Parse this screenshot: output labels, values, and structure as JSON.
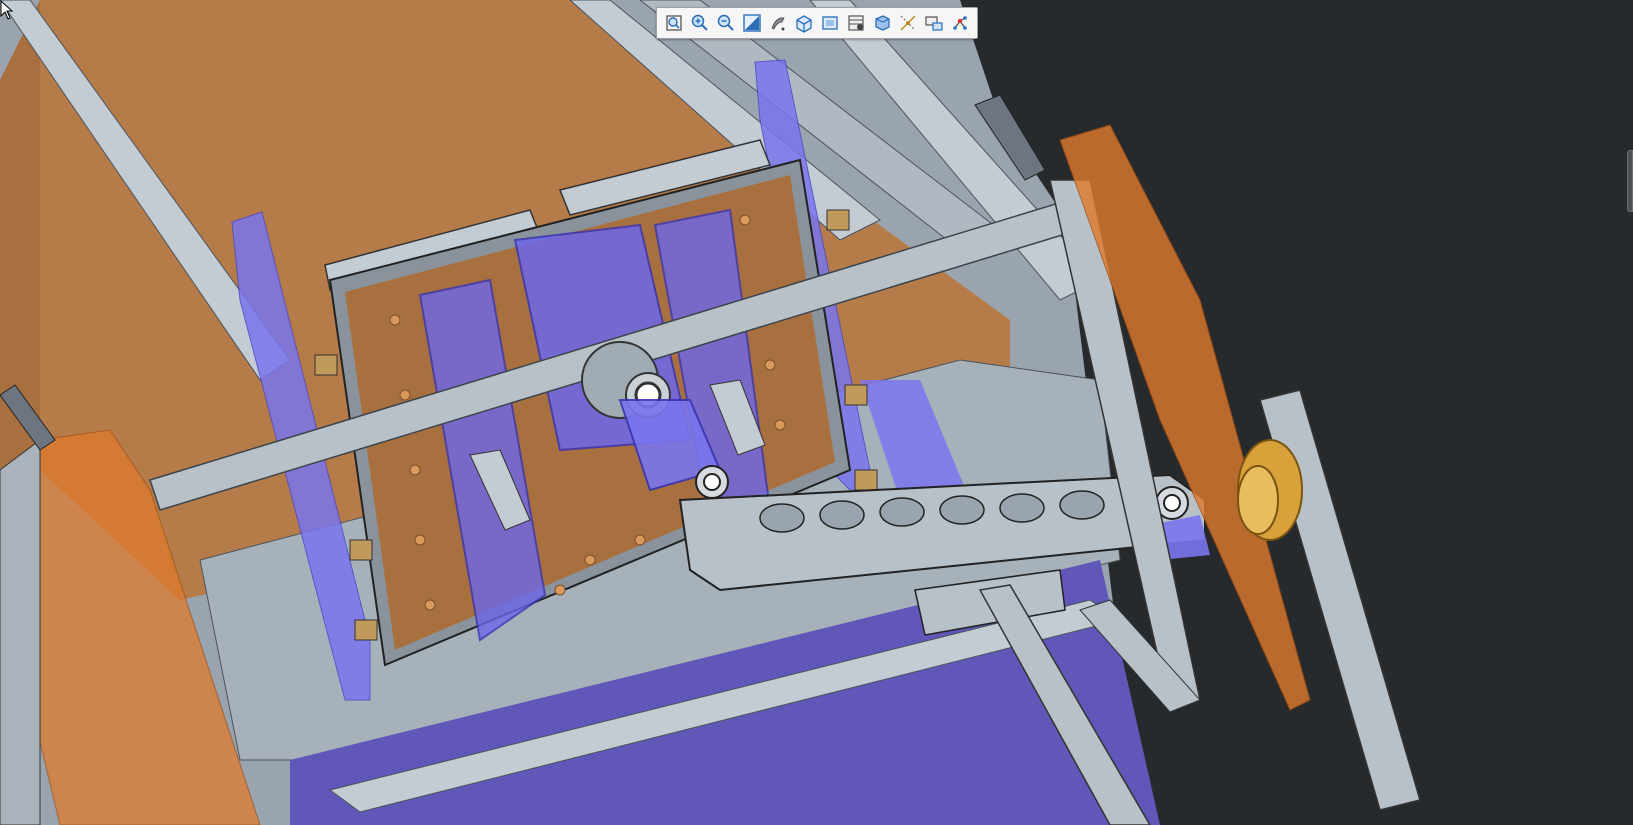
{
  "app": {
    "view": "3d-cad-assembly-viewport"
  },
  "colors": {
    "background": "#262a2c",
    "steel": "#b8c0c8",
    "steel_dark": "#8f99a3",
    "wood": "#b57c4a",
    "transparent_orange": "#e07a2d",
    "transparent_blue": "#6b6bf2",
    "bearing_gold": "#d9a13a"
  },
  "toolbar": {
    "buttons": [
      {
        "icon": "zoom-fit-icon",
        "name": "zoom-fit-button"
      },
      {
        "icon": "zoom-in-icon",
        "name": "zoom-in-button"
      },
      {
        "icon": "zoom-out-icon",
        "name": "zoom-out-button"
      },
      {
        "icon": "zoom-window-icon",
        "name": "zoom-window-button"
      },
      {
        "icon": "repaint-icon",
        "name": "repaint-button"
      },
      {
        "icon": "display-style-icon",
        "name": "display-style-button"
      },
      {
        "icon": "saved-views-icon",
        "name": "saved-views-button"
      },
      {
        "icon": "view-manager-icon",
        "name": "view-manager-button"
      },
      {
        "icon": "perspective-icon",
        "name": "perspective-button"
      },
      {
        "icon": "datum-display-icon",
        "name": "datum-display-button"
      },
      {
        "icon": "annotation-display-icon",
        "name": "annotation-display-button"
      },
      {
        "icon": "spin-center-icon",
        "name": "spin-center-button"
      }
    ]
  }
}
